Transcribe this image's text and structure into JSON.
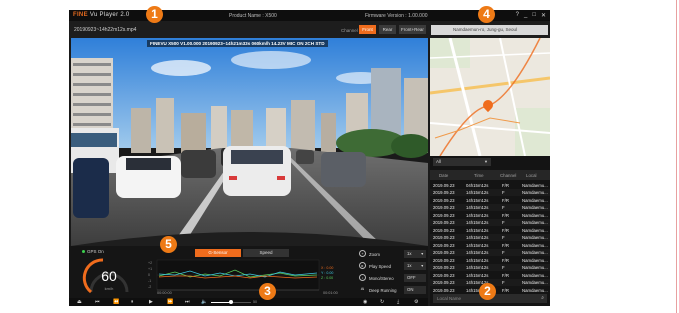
{
  "titlebar": {
    "logo": "FINE",
    "logo_sub": "Vu Player 2.0",
    "product": "Product Name : X500",
    "firmware": "Firmware Version : 1.00.000",
    "buttons": [
      "?",
      "_",
      "□",
      "✕"
    ]
  },
  "file": {
    "name": "20190923~14h22m12s.mp4"
  },
  "channel": {
    "label": "Channel",
    "buttons": [
      {
        "label": "Front",
        "active": true
      },
      {
        "label": "Rear",
        "active": false
      },
      {
        "label": "Front+Rear",
        "active": false
      }
    ]
  },
  "video": {
    "osd": "FINEVU X500 V1.00.000  20190923~14h21m33s  060km/h  14.23V  MIC ON 2CH STD"
  },
  "map": {
    "location": "Namdaemun-ro, Jung-gu, Seoul"
  },
  "list": {
    "filter": "All",
    "headers": [
      "Date",
      "Time",
      "Channel",
      "Local"
    ],
    "rows": [
      [
        "2019.09.23",
        "04h15m12s",
        "F/R",
        "Namdaemu..."
      ],
      [
        "2019.09.23",
        "14h15m12s",
        "F",
        "Namdaemu..."
      ],
      [
        "2019.09.23",
        "14h15m12s",
        "F/R",
        "Namdaemu..."
      ],
      [
        "2019.09.23",
        "14h15m12s",
        "F",
        "Namdaemu..."
      ],
      [
        "2019.09.23",
        "14h15m12s",
        "F/R",
        "Namdaemu..."
      ],
      [
        "2019.09.23",
        "14h15m12s",
        "F",
        "Namdaemu..."
      ],
      [
        "2019.09.23",
        "14h15m12s",
        "F/R",
        "Namdaemu..."
      ],
      [
        "2019.09.23",
        "14h15m12s",
        "F",
        "Namdaemu..."
      ],
      [
        "2019.09.23",
        "14h15m12s",
        "F/R",
        "Namdaemu..."
      ],
      [
        "2019.09.23",
        "14h15m12s",
        "F",
        "Namdaemu..."
      ],
      [
        "2019.09.23",
        "14h15m12s",
        "F/R",
        "Namdaemu..."
      ],
      [
        "2019.09.23",
        "14h15m12s",
        "F",
        "Namdaemu..."
      ],
      [
        "2019.09.23",
        "14h15m12s",
        "F/R",
        "Namdaemu..."
      ],
      [
        "2019.09.23",
        "14h15m12s",
        "F",
        "Namdaemu..."
      ],
      [
        "2019.09.23",
        "14h15m12s",
        "F/R",
        "Namdaemu..."
      ]
    ],
    "search_placeholder": "Local Name"
  },
  "gps": {
    "status": "GPS On",
    "speed": "60",
    "unit": "km/h"
  },
  "gsensor": {
    "tabs": [
      {
        "label": "G-Sensor",
        "active": true
      },
      {
        "label": "Speed",
        "active": false
      }
    ],
    "y_ticks": [
      "+2",
      "+1",
      "0",
      "-1",
      "-2"
    ],
    "legend": [
      "X : 0.00",
      "Y : 0.00",
      "Z : 0.00"
    ],
    "time_start": "00:00:00",
    "time_end": "00:01:00"
  },
  "settings": [
    {
      "icon": "zoom-icon",
      "label": "Zoom",
      "value": "1x"
    },
    {
      "icon": "play-speed-icon",
      "label": "Play Speed",
      "value": "1x"
    },
    {
      "icon": "mono-icon",
      "label": "Mono/Stereo",
      "value": "OFF"
    },
    {
      "icon": "deep-running-icon",
      "label": "Deep Running",
      "value": "ON"
    }
  ],
  "controls": {
    "volume_label": "50",
    "buttons": [
      "eject-icon",
      "prev-file-icon",
      "rewind-icon",
      "pause-icon",
      "fast-forward-icon",
      "next-file-icon",
      "volume-icon"
    ]
  },
  "markers": [
    "1",
    "2",
    "3",
    "4",
    "5"
  ],
  "colors": {
    "accent": "#ef6c1d",
    "marker": "#ee7a16",
    "gps_on": "#3ccf4e",
    "gx": "#ef6c1d",
    "gy": "#3ec6e0",
    "gz": "#5bd05b"
  }
}
